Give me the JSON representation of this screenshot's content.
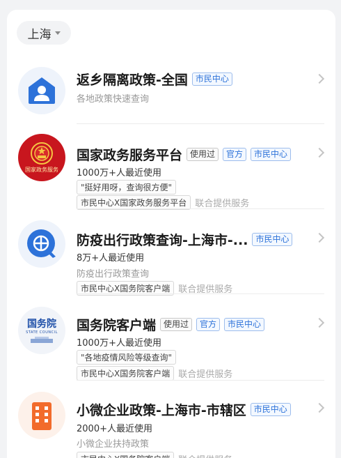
{
  "city_selector": {
    "label": "上海"
  },
  "items": [
    {
      "title": "返乡隔离政策-全国",
      "tags": [
        "市民中心"
      ],
      "line1": "各地政策快速查询"
    },
    {
      "title": "国家政务服务平台",
      "tags": [
        "使用过",
        "官方",
        "市民中心"
      ],
      "usage": "1000万+人最近使用",
      "quote": "\"挺好用呀，查询很方便\"",
      "source": "市民中心X国家政务服务平台",
      "source_suffix": "联合提供服务",
      "logo_text": "国家政务服务"
    },
    {
      "title": "防疫出行政策查询-上海市-...",
      "tags": [
        "市民中心"
      ],
      "usage": "8万+人最近使用",
      "line2": "防疫出行政策查询",
      "source": "市民中心X国务院客户端",
      "source_suffix": "联合提供服务"
    },
    {
      "title": "国务院客户端",
      "tags": [
        "使用过",
        "官方",
        "市民中心"
      ],
      "usage": "1000万+人最近使用",
      "quote": "\"各地疫情风险等级查询\"",
      "source": "市民中心X国务院客户端",
      "source_suffix": "联合提供服务",
      "logo_text": "国务院",
      "logo_subtext": "STATE COUNCIL"
    },
    {
      "title": "小微企业政策-上海市-市辖区",
      "tags": [
        "市民中心"
      ],
      "usage": "2000+人最近使用",
      "line2": "小微企业扶持政策",
      "source": "市民中心X国务院客户端",
      "source_suffix": "联合提供服务"
    }
  ],
  "colors": {
    "accent_blue": "#2d72d9",
    "emblem_red": "#c8161e",
    "orange": "#f26b2b"
  },
  "icons": [
    "house-person-icon",
    "national-emblem-icon",
    "globe-search-icon",
    "state-council-icon",
    "building-icon",
    "chevron-right-icon",
    "caret-down-icon"
  ]
}
